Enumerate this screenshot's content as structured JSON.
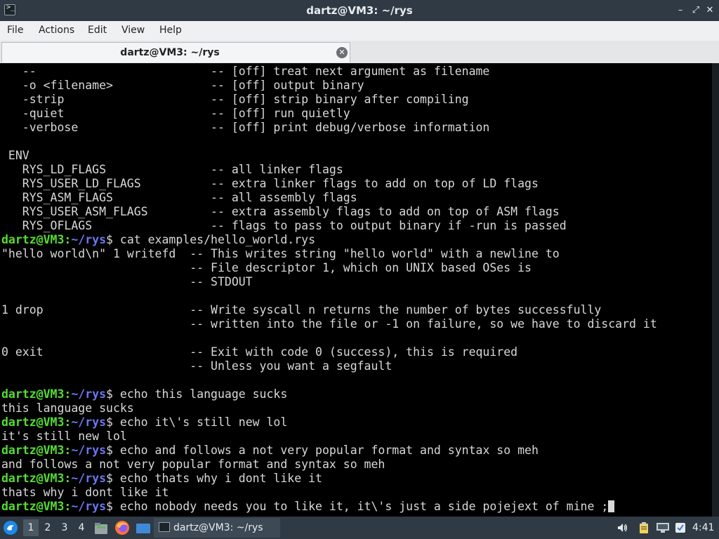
{
  "window": {
    "title": "dartz@VM3: ~/rys"
  },
  "menu": [
    "File",
    "Actions",
    "Edit",
    "View",
    "Help"
  ],
  "tab": {
    "label": "dartz@VM3: ~/rys"
  },
  "colors": {
    "prompt_user": "#55dd33",
    "prompt_path": "#6b77ee",
    "terminal_bg": "#000000",
    "terminal_fg": "#d8d8d8"
  },
  "terminal": {
    "prompt_user": "dartz@VM3",
    "prompt_path": "~/rys",
    "lines": [
      {
        "text": "   --                         -- [off] treat next argument as filename"
      },
      {
        "text": "   -o <filename>              -- [off] output binary"
      },
      {
        "text": "   -strip                     -- [off] strip binary after compiling"
      },
      {
        "text": "   -quiet                     -- [off] run quietly"
      },
      {
        "text": "   -verbose                   -- [off] print debug/verbose information"
      },
      {
        "text": ""
      },
      {
        "text": " ENV"
      },
      {
        "text": "   RYS_LD_FLAGS               -- all linker flags"
      },
      {
        "text": "   RYS_USER_LD_FLAGS          -- extra linker flags to add on top of LD flags"
      },
      {
        "text": "   RYS_ASM_FLAGS              -- all assembly flags"
      },
      {
        "text": "   RYS_USER_ASM_FLAGS         -- extra assembly flags to add on top of ASM flags"
      },
      {
        "text": "   RYS_OFLAGS                 -- flags to pass to output binary if -run is passed"
      },
      {
        "prompt": true,
        "cmd": "$ cat examples/hello_world.rys"
      },
      {
        "text": "\"hello world\\n\" 1 writefd  -- This writes string \"hello world\" with a newline to"
      },
      {
        "text": "                           -- File descriptor 1, which on UNIX based OSes is"
      },
      {
        "text": "                           -- STDOUT"
      },
      {
        "text": ""
      },
      {
        "text": "1 drop                     -- Write syscall n returns the number of bytes successfully"
      },
      {
        "text": "                           -- written into the file or -1 on failure, so we have to discard it"
      },
      {
        "text": ""
      },
      {
        "text": "0 exit                     -- Exit with code 0 (success), this is required"
      },
      {
        "text": "                           -- Unless you want a segfault"
      },
      {
        "text": ""
      },
      {
        "prompt": true,
        "cmd": "$ echo this language sucks"
      },
      {
        "text": "this language sucks"
      },
      {
        "prompt": true,
        "cmd": "$ echo it\\'s still new lol"
      },
      {
        "text": "it's still new lol"
      },
      {
        "prompt": true,
        "cmd": "$ echo and follows a not very popular format and syntax so meh"
      },
      {
        "text": "and follows a not very popular format and syntax so meh"
      },
      {
        "prompt": true,
        "cmd": "$ echo thats why i dont like it"
      },
      {
        "text": "thats why i dont like it"
      },
      {
        "prompt": true,
        "cmd": "$ echo nobody needs you to like it, it\\'s just a side pojejext of mine ;",
        "cursor": true
      }
    ]
  },
  "taskbar": {
    "workspaces": [
      "1",
      "2",
      "3",
      "4"
    ],
    "active_workspace": "1",
    "task_label": "dartz@VM3: ~/rys",
    "clock": "4:41"
  }
}
